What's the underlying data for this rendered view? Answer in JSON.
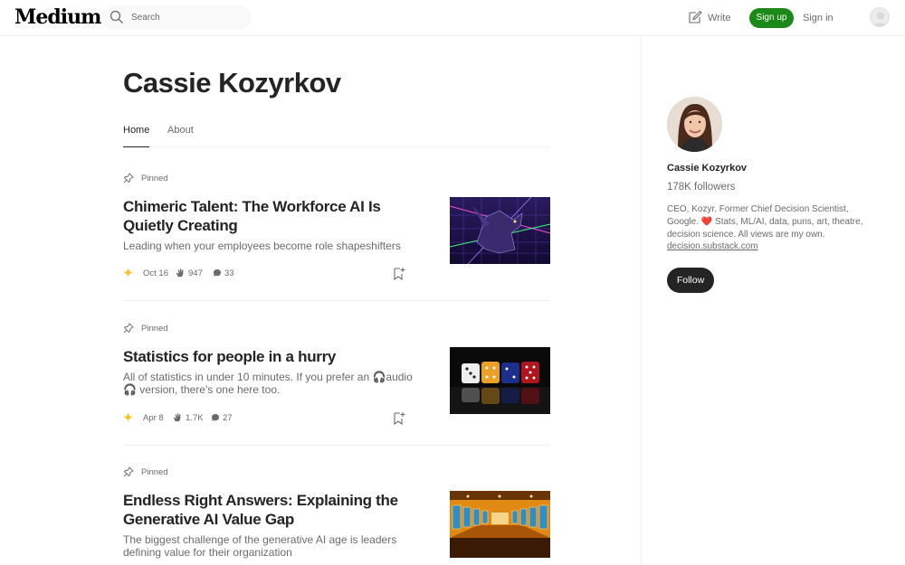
{
  "header": {
    "logo": "Medium",
    "search_placeholder": "Search",
    "write_label": "Write",
    "signup_label": "Sign up",
    "signin_label": "Sign in"
  },
  "profile": {
    "name": "Cassie Kozyrkov",
    "tabs": [
      {
        "label": "Home",
        "active": true
      },
      {
        "label": "About",
        "active": false
      }
    ]
  },
  "articles": [
    {
      "pinned_label": "Pinned",
      "title": "Chimeric Talent: The Workforce AI Is Quietly Creating",
      "subtitle": "Leading when your employees become role shapeshifters",
      "date": "Oct 16",
      "claps": "947",
      "responses": "33",
      "thumbnail": "purple-griffin-synthwave-grid"
    },
    {
      "pinned_label": "Pinned",
      "title": "Statistics for people in a hurry",
      "subtitle": "All of statistics in under 10 minutes. If you prefer an 🎧audio🎧 version, there's one here too.",
      "date": "Apr 8",
      "claps": "1.7K",
      "responses": "27",
      "thumbnail": "row-of-dice"
    },
    {
      "pinned_label": "Pinned",
      "title": "Endless Right Answers: Explaining the Generative AI Value Gap",
      "subtitle": "The biggest challenge of the generative AI age is leaders defining value for their organization",
      "thumbnail": "orange-gallery-hall"
    }
  ],
  "sidebar": {
    "name": "Cassie Kozyrkov",
    "followers": "178K followers",
    "bio": "CEO, Kozyr. Former Chief Decision Scientist, Google. ❤️ Stats, ML/AI, data, puns, art, theatre, decision science. All views are my own.",
    "link": "decision.substack.com",
    "follow_label": "Follow"
  },
  "colors": {
    "brand_green": "#1a8917",
    "text_primary": "#242424",
    "text_secondary": "#6b6b6b",
    "member_star": "#ffc017"
  }
}
